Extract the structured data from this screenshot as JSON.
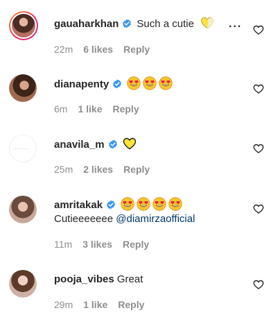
{
  "colors": {
    "text": "#262626",
    "muted": "#8e8e8e",
    "mention": "#00376b",
    "verified": "#3897f0"
  },
  "comments": [
    {
      "username": "gauaharkhan",
      "verified": true,
      "text": "Such a cutie",
      "emoji": "yellow-heart",
      "time": "22m",
      "likes": "6 likes",
      "reply": "Reply",
      "more": "..."
    },
    {
      "username": "dianapenty",
      "verified": true,
      "text": "",
      "emoji": "heart-eyes x3",
      "time": "6m",
      "likes": "1 like",
      "reply": "Reply"
    },
    {
      "username": "anavila_m",
      "verified": true,
      "text": "",
      "emoji": "yellow-heart",
      "time": "25m",
      "likes": "2 likes",
      "reply": "Reply"
    },
    {
      "username": "amritakak",
      "verified": true,
      "text": "Cutieeeeeee",
      "mention": "@diamirzaofficial",
      "emoji": "heart-eyes x4",
      "time": "11m",
      "likes": "3 likes",
      "reply": "Reply"
    },
    {
      "username": "pooja_vibes",
      "verified": false,
      "text": "Great",
      "time": "29m",
      "likes": "1 like",
      "reply": "Reply"
    }
  ]
}
